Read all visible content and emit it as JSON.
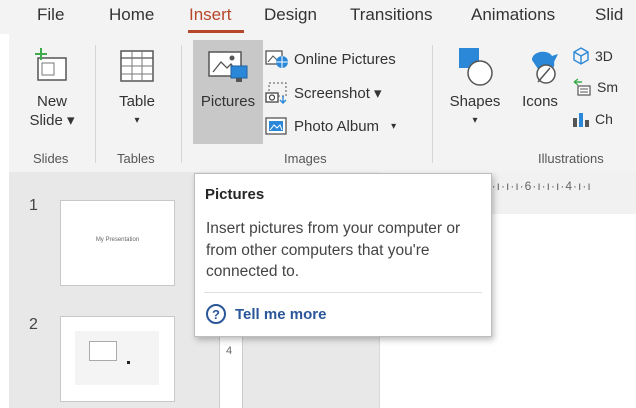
{
  "menu": {
    "tabs": [
      {
        "label": "File"
      },
      {
        "label": "Home"
      },
      {
        "label": "Insert"
      },
      {
        "label": "Design"
      },
      {
        "label": "Transitions"
      },
      {
        "label": "Animations"
      },
      {
        "label": "Slid"
      }
    ]
  },
  "ribbon": {
    "new_slide_line1": "New",
    "new_slide_line2": "Slide ▾",
    "table_label": "Table",
    "table_arrow": "▾",
    "pictures_label": "Pictures",
    "online_pictures": "Online Pictures",
    "screenshot": "Screenshot ▾",
    "photo_album": "Photo Album",
    "photo_album_arrow": "▾",
    "shapes_label": "Shapes",
    "shapes_arrow": "▾",
    "icons_label": "Icons",
    "threed_label": "3D",
    "smartart_label": "Sm",
    "chart_label": "Ch",
    "groups": {
      "slides": "Slides",
      "tables": "Tables",
      "images": "Images",
      "illustrations": "Illustrations"
    }
  },
  "slides": {
    "items": [
      {
        "number": "1",
        "thumb_text": "My Presentation"
      },
      {
        "number": "2",
        "thumb_text": ""
      }
    ]
  },
  "ruler": {
    "horizontal": "8·ı·ı·ı·6·ı·ı·ı·4·ı·ı",
    "vertical": "4"
  },
  "tooltip": {
    "title": "Pictures",
    "body": "Insert pictures from your computer or from other computers that you're connected to.",
    "help_icon": "?",
    "help_label": "Tell me more"
  },
  "colors": {
    "accent": "#b7472a",
    "help_link": "#2b579a"
  }
}
